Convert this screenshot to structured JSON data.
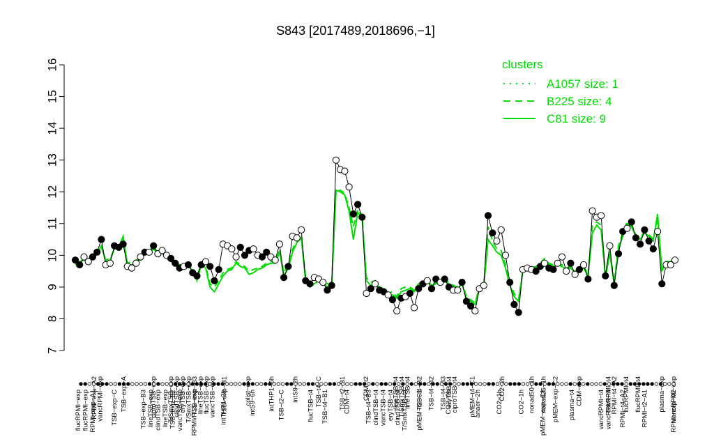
{
  "chart_data": {
    "type": "line",
    "title": "S843 [2017489,2018696,−1]",
    "xlabel": "",
    "ylabel": "",
    "ylim": [
      7,
      16
    ],
    "yticks": [
      7,
      8,
      9,
      10,
      11,
      12,
      13,
      14,
      15,
      16
    ],
    "legend": {
      "title": "clusters",
      "position": "top-right",
      "color": "#00dd00",
      "entries": [
        {
          "label": "A1057 size: 1",
          "style": "dotted"
        },
        {
          "label": "B225 size: 4",
          "style": "dashed"
        },
        {
          "label": "C81 size: 9",
          "style": "solid"
        }
      ]
    },
    "colors": {
      "points_line": "#000000",
      "cluster": "#00dd00"
    },
    "x_ticks_top": [
      {
        "x": 2,
        "label": "RPMI−exp−A2"
      },
      {
        "x": 3,
        "label": "vancRPMI−exp"
      },
      {
        "x": 7,
        "label": "TSB−exp−A"
      },
      {
        "x": 12,
        "label": "ciproTSB−exp"
      },
      {
        "x": 15,
        "label": "T/SmxTSB−exp"
      },
      {
        "x": 16,
        "label": "clindTSB−exp"
      },
      {
        "x": 17,
        "label": "eryTSB−exp"
      },
      {
        "x": 18,
        "label": "T/SmxTSB−exp"
      },
      {
        "x": 19,
        "label": "TSB−exp−B3"
      },
      {
        "x": 20,
        "label": "lineTSB−exp"
      },
      {
        "x": 21,
        "label": "flucTSB−exp"
      },
      {
        "x": 22,
        "label": "vancTSB−exp"
      },
      {
        "x": 24,
        "label": "TSB−exp−B1"
      },
      {
        "x": 28,
        "label": "colist−exp"
      },
      {
        "x": 32,
        "label": "intTHP1−6h"
      },
      {
        "x": 36,
        "label": "intS9−2h"
      },
      {
        "x": 40,
        "label": "TSB−t4−C"
      },
      {
        "x": 44,
        "label": "TSB−t2−B1"
      },
      {
        "x": 48,
        "label": "CDM−t2"
      },
      {
        "x": 53,
        "label": "lineTSB−t4"
      },
      {
        "x": 54,
        "label": "T/SmxTSB−t4"
      },
      {
        "x": 55,
        "label": "lineTSB−t4"
      },
      {
        "x": 57,
        "label": "TSB−t4−B2"
      },
      {
        "x": 59,
        "label": "TSB−t4−B2"
      },
      {
        "x": 61,
        "label": "TSB−t4−B3"
      },
      {
        "x": 62,
        "label": "eryTSB−t4"
      },
      {
        "x": 63,
        "label": "ciproTSB−t4"
      },
      {
        "x": 66,
        "label": "pMEM−t4−C1"
      },
      {
        "x": 71,
        "label": "CO2−2h"
      },
      {
        "x": 76,
        "label": "nonad50−1h"
      },
      {
        "x": 78,
        "label": "nonad25−1h"
      },
      {
        "x": 80,
        "label": "pMEM−exp−C2"
      },
      {
        "x": 84,
        "label": "CDM−exp"
      },
      {
        "x": 89,
        "label": "flucRPMI−t4"
      },
      {
        "x": 90,
        "label": "RPMI−t4−A2"
      },
      {
        "x": 92,
        "label": "flucRPMI−t4"
      },
      {
        "x": 94,
        "label": "flucRPMI−t4"
      },
      {
        "x": 98,
        "label": "plasma−exp"
      },
      {
        "x": 100,
        "label": "vancRPMI−exp"
      }
    ],
    "x_ticks_bottom": [
      {
        "x": 0,
        "label": "flucRPMI−exp"
      },
      {
        "x": 1,
        "label": "flucRPMI−exp"
      },
      {
        "x": 2,
        "label": "RPMI−exp−A1"
      },
      {
        "x": 5,
        "label": "TSB−exp−C"
      },
      {
        "x": 9,
        "label": "TSB−exp−B3"
      },
      {
        "x": 10,
        "label": "lineTSB−exp"
      },
      {
        "x": 11,
        "label": "clindTSB−exp"
      },
      {
        "x": 12,
        "label": "lineTSB−exp"
      },
      {
        "x": 13,
        "label": "TSB−exp−B2"
      },
      {
        "x": 14,
        "label": "vancTSB−exp"
      },
      {
        "x": 16,
        "label": "RPMI/FCS−exp"
      },
      {
        "x": 20,
        "label": "intTHP1−2h"
      },
      {
        "x": 24,
        "label": "intS9−6h"
      },
      {
        "x": 28,
        "label": "TSB−t2−C"
      },
      {
        "x": 32,
        "label": "flucTSB−t4"
      },
      {
        "x": 34,
        "label": "TSB−t4−B1"
      },
      {
        "x": 37,
        "label": "CDM−t4"
      },
      {
        "x": 40,
        "label": "TSB−t4−B3"
      },
      {
        "x": 41,
        "label": "clindTSB−t4"
      },
      {
        "x": 42,
        "label": "vancTSB−t4"
      },
      {
        "x": 43,
        "label": "eryTSB−t4"
      },
      {
        "x": 44,
        "label": "clindTSB−t4"
      },
      {
        "x": 45,
        "label": "T/SmxTSB−t4"
      },
      {
        "x": 47,
        "label": "pMEM−t2−C1"
      },
      {
        "x": 51,
        "label": "CO2−6h"
      },
      {
        "x": 55,
        "label": "anaer−2h"
      },
      {
        "x": 58,
        "label": "CO2−1h"
      },
      {
        "x": 61,
        "label": "CO2−1h"
      },
      {
        "x": 64,
        "label": "pMEM−exp−C1"
      },
      {
        "x": 68,
        "label": "plasma−t4"
      },
      {
        "x": 72,
        "label": "vancRPMI−t4"
      },
      {
        "x": 73,
        "label": "vancRPMI−t4"
      },
      {
        "x": 75,
        "label": "RPMI−t4−A2"
      },
      {
        "x": 78,
        "label": "RPMI−t2−A1"
      },
      {
        "x": 82,
        "label": "RPMI−exp−A2"
      }
    ],
    "series": [
      {
        "style": "points-line",
        "values": [
          9.85,
          9.7,
          9.95,
          9.8,
          9.95,
          10.1,
          10.5,
          9.7,
          9.75,
          10.3,
          10.25,
          10.35,
          9.65,
          9.6,
          9.75,
          9.95,
          10.1,
          10.1,
          10.3,
          10.05,
          10.15,
          10.0,
          9.9,
          9.75,
          9.6,
          9.65,
          9.7,
          9.45,
          9.35,
          9.7,
          9.8,
          9.65,
          9.2,
          9.55,
          10.35,
          10.3,
          10.2,
          9.95,
          10.25,
          10.0,
          10.15,
          10.2,
          10.0,
          9.95,
          10.1,
          9.95,
          9.85,
          10.35,
          9.3,
          9.65,
          10.6,
          10.55,
          10.8,
          9.2,
          9.1,
          9.3,
          9.25,
          9.15,
          8.9,
          9.05,
          13.0,
          12.7,
          12.65,
          12.15,
          11.3,
          11.6,
          11.2,
          8.8,
          8.95,
          9.1,
          8.9,
          8.85,
          8.75,
          8.6,
          8.25,
          8.65,
          8.7,
          8.8,
          8.35,
          8.95,
          9.1,
          9.2,
          8.95,
          9.25,
          9.15,
          9.25,
          9.0,
          8.9,
          8.9,
          9.15,
          8.55,
          8.4,
          8.25,
          8.95,
          9.05,
          11.25,
          10.7,
          10.45,
          10.8,
          10.0,
          9.15,
          8.45,
          8.2,
          9.55,
          9.6,
          9.55,
          9.5,
          9.65,
          9.75,
          9.6,
          9.55,
          9.75,
          9.95,
          9.5,
          9.75,
          9.4,
          9.55,
          9.7,
          9.25,
          11.4,
          11.2,
          11.25,
          9.35,
          10.3,
          9.05,
          10.05,
          10.75,
          10.85,
          11.05,
          10.55,
          10.35,
          10.8,
          10.45,
          10.2,
          10.75,
          9.1,
          9.7,
          9.7,
          9.85
        ],
        "filled": [
          1,
          1,
          0,
          0,
          1,
          1,
          1,
          0,
          0,
          1,
          1,
          1,
          0,
          0,
          0,
          0,
          1,
          0,
          1,
          0,
          0,
          0,
          1,
          1,
          1,
          0,
          1,
          1,
          1,
          1,
          0,
          1,
          1,
          1,
          0,
          0,
          0,
          0,
          1,
          1,
          1,
          0,
          0,
          1,
          1,
          0,
          0,
          0,
          1,
          1,
          0,
          0,
          0,
          1,
          1,
          0,
          0,
          0,
          1,
          1,
          0,
          0,
          0,
          0,
          1,
          1,
          1,
          0,
          1,
          0,
          1,
          1,
          0,
          1,
          0,
          1,
          0,
          1,
          0,
          1,
          1,
          0,
          1,
          1,
          0,
          1,
          1,
          0,
          0,
          1,
          1,
          1,
          0,
          0,
          0,
          1,
          1,
          0,
          0,
          0,
          1,
          1,
          1,
          0,
          0,
          0,
          1,
          1,
          0,
          1,
          1,
          0,
          0,
          0,
          1,
          0,
          1,
          0,
          1,
          0,
          0,
          0,
          1,
          0,
          1,
          1,
          1,
          0,
          1,
          1,
          1,
          1,
          1,
          1,
          0,
          1,
          0,
          0,
          0,
          1
        ]
      },
      {
        "name": "C81 size: 9",
        "style": "solid",
        "values": [
          9.7,
          9.8,
          9.85,
          9.85,
          9.9,
          10.05,
          10.3,
          9.8,
          9.85,
          10.2,
          10.25,
          10.6,
          9.7,
          9.7,
          9.8,
          9.85,
          10.05,
          10.15,
          10.25,
          10.1,
          10.1,
          9.95,
          9.85,
          9.75,
          9.7,
          9.65,
          9.7,
          9.5,
          9.2,
          9.7,
          9.6,
          9.0,
          8.85,
          9.1,
          9.35,
          9.5,
          9.55,
          9.75,
          9.65,
          9.6,
          9.4,
          9.45,
          9.55,
          9.6,
          9.7,
          9.75,
          9.75,
          10.1,
          9.35,
          9.6,
          10.1,
          10.4,
          10.55,
          9.2,
          9.0,
          9.1,
          9.2,
          9.15,
          9.0,
          9.05,
          12.05,
          12.0,
          11.9,
          11.4,
          10.5,
          11.35,
          11.2,
          9.2,
          9.05,
          9.1,
          8.95,
          8.85,
          8.7,
          8.75,
          8.65,
          8.85,
          8.9,
          8.95,
          8.85,
          9.05,
          9.15,
          9.2,
          9.05,
          9.1,
          9.15,
          9.2,
          9.1,
          9.0,
          8.95,
          9.1,
          8.65,
          8.55,
          8.45,
          8.95,
          9.0,
          10.5,
          10.3,
          10.1,
          10.0,
          9.6,
          9.05,
          8.7,
          8.55,
          9.5,
          9.6,
          9.55,
          9.6,
          9.7,
          9.85,
          9.7,
          9.65,
          9.7,
          9.65,
          9.55,
          9.6,
          9.45,
          9.5,
          9.6,
          9.35,
          10.7,
          10.95,
          10.8,
          9.3,
          10.05,
          9.1,
          10.2,
          10.6,
          11.0,
          10.9,
          10.6,
          10.5,
          10.7,
          10.6,
          10.45,
          11.3,
          9.5,
          9.8,
          9.75,
          9.85
        ]
      },
      {
        "name": "B225 size: 4",
        "style": "dashed",
        "values": [
          9.75,
          9.8,
          9.85,
          9.9,
          9.95,
          10.05,
          10.25,
          9.85,
          9.9,
          10.2,
          10.3,
          10.5,
          9.75,
          9.8,
          9.85,
          9.9,
          10.05,
          10.1,
          10.2,
          10.05,
          10.05,
          9.95,
          9.8,
          9.75,
          9.7,
          9.7,
          9.75,
          9.55,
          9.3,
          9.75,
          9.65,
          9.1,
          9.0,
          9.2,
          9.45,
          9.55,
          9.6,
          9.8,
          9.7,
          9.65,
          9.5,
          9.55,
          9.6,
          9.65,
          9.75,
          9.8,
          9.8,
          10.15,
          9.45,
          9.7,
          10.2,
          10.45,
          10.6,
          9.3,
          9.1,
          9.2,
          9.3,
          9.2,
          9.1,
          9.1,
          12.0,
          12.05,
          11.95,
          11.5,
          10.9,
          11.45,
          11.25,
          9.3,
          9.15,
          9.2,
          9.0,
          8.95,
          8.8,
          8.85,
          8.7,
          8.95,
          9.0,
          9.0,
          8.9,
          9.1,
          9.2,
          9.25,
          9.1,
          9.15,
          9.2,
          9.25,
          9.15,
          9.05,
          9.0,
          9.15,
          8.7,
          8.6,
          8.5,
          9.0,
          9.05,
          10.9,
          10.45,
          10.2,
          10.15,
          9.7,
          9.1,
          8.8,
          8.6,
          9.55,
          9.65,
          9.6,
          9.65,
          9.75,
          9.9,
          9.75,
          9.7,
          9.75,
          9.7,
          9.6,
          9.65,
          9.5,
          9.55,
          9.65,
          9.4,
          10.95,
          11.05,
          10.95,
          9.4,
          10.15,
          9.15,
          10.3,
          10.7,
          11.05,
          10.95,
          10.65,
          10.55,
          10.75,
          10.65,
          10.5,
          11.1,
          9.55,
          9.8,
          9.8,
          9.9
        ]
      }
    ]
  }
}
